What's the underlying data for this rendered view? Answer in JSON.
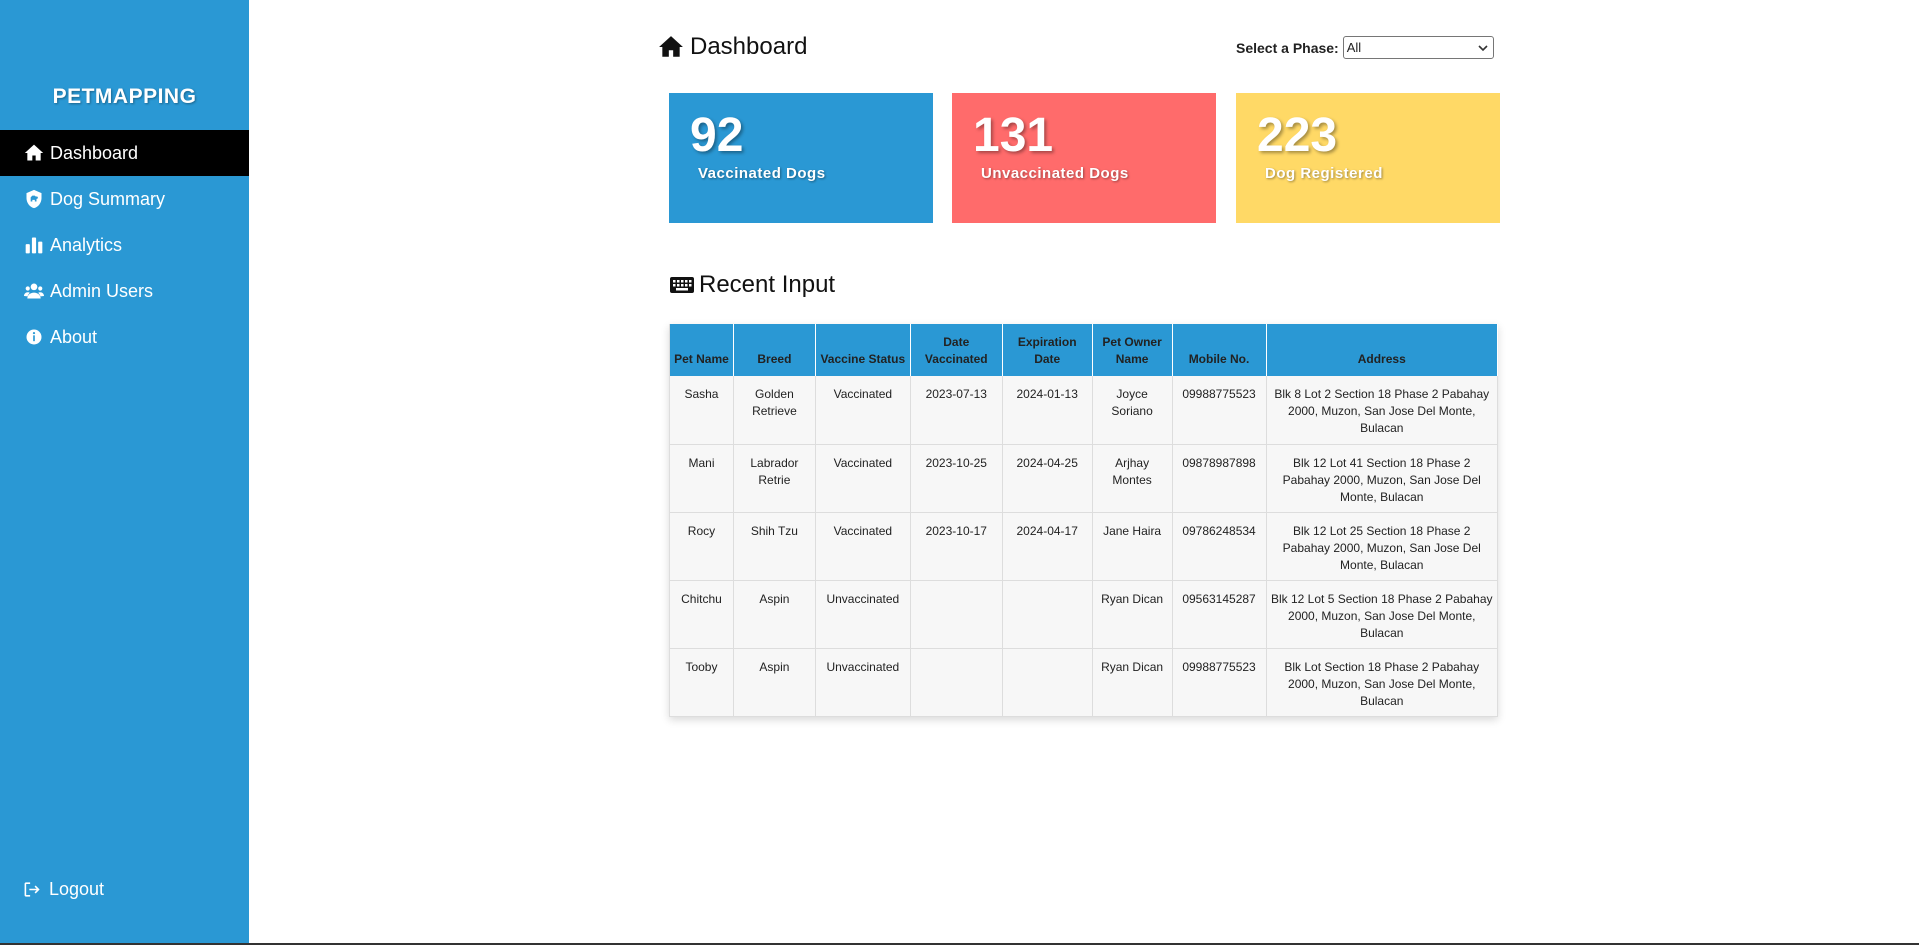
{
  "app": {
    "brand": "PETMAPPING"
  },
  "sidebar": {
    "items": [
      {
        "label": "Dashboard",
        "icon": "home-icon",
        "active": true
      },
      {
        "label": "Dog Summary",
        "icon": "shield-dog-icon",
        "active": false
      },
      {
        "label": "Analytics",
        "icon": "chart-bars-icon",
        "active": false
      },
      {
        "label": "Admin Users",
        "icon": "users-icon",
        "active": false
      },
      {
        "label": "About",
        "icon": "info-circle-icon",
        "active": false
      }
    ],
    "logout_label": "Logout"
  },
  "header": {
    "title": "Dashboard",
    "phase_label": "Select a Phase:",
    "phase_value": "All"
  },
  "cards": [
    {
      "value": "92",
      "label": "Vaccinated Dogs",
      "color": "#2a98d4"
    },
    {
      "value": "131",
      "label": "Unvaccinated Dogs",
      "color": "#ff6b6b"
    },
    {
      "value": "223",
      "label": "Dog Registered",
      "color": "#ffd966"
    }
  ],
  "recent": {
    "title": "Recent Input",
    "columns": [
      "Pet Name",
      "Breed",
      "Vaccine Status",
      "Date Vaccinated",
      "Expiration Date",
      "Pet Owner Name",
      "Mobile No.",
      "Address"
    ],
    "rows": [
      [
        "Sasha",
        "Golden Retrieve",
        "Vaccinated",
        "2023-07-13",
        "2024-01-13",
        "Joyce Soriano",
        "09988775523",
        "Blk 8 Lot 2 Section 18 Phase 2 Pabahay 2000, Muzon, San Jose Del Monte, Bulacan"
      ],
      [
        "Mani",
        "Labrador Retrie",
        "Vaccinated",
        "2023-10-25",
        "2024-04-25",
        "Arjhay Montes",
        "09878987898",
        "Blk 12 Lot 41 Section 18 Phase 2 Pabahay 2000, Muzon, San Jose Del Monte, Bulacan"
      ],
      [
        "Rocy",
        "Shih Tzu",
        "Vaccinated",
        "2023-10-17",
        "2024-04-17",
        "Jane Haira",
        "09786248534",
        "Blk 12 Lot 25 Section 18 Phase 2 Pabahay 2000, Muzon, San Jose Del Monte, Bulacan"
      ],
      [
        "Chitchu",
        "Aspin",
        "Unvaccinated",
        "",
        "",
        "Ryan Dican",
        "09563145287",
        "Blk 12 Lot 5 Section 18 Phase 2 Pabahay 2000, Muzon, San Jose Del Monte, Bulacan"
      ],
      [
        "Tooby",
        "Aspin",
        "Unvaccinated",
        "",
        "",
        "Ryan Dican",
        "09988775523",
        "Blk Lot Section 18 Phase 2 Pabahay 2000, Muzon, San Jose Del Monte, Bulacan"
      ]
    ]
  }
}
